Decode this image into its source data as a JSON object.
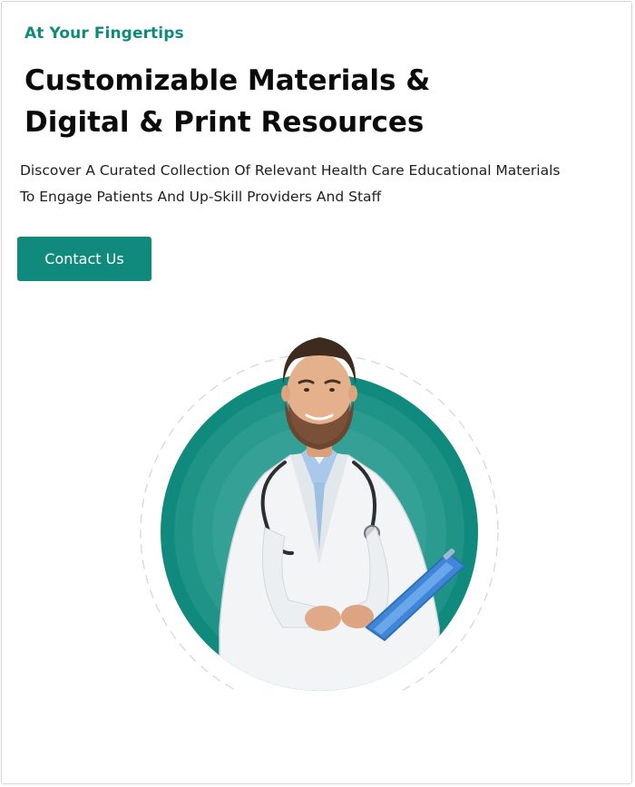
{
  "hero": {
    "eyebrow": "At Your Fingertips",
    "headline_line1": "Customizable Materials &",
    "headline_line2": "Digital & Print Resources",
    "description_line1": "Discover A Curated Collection Of Relevant Health Care Educational Materials",
    "description_line2": "To Engage Patients And Up-Skill Providers And Staff",
    "cta_label": "Contact Us"
  },
  "colors": {
    "accent": "#0f8a7c",
    "headline": "#0b0b0b",
    "body_text": "#1e1e1e",
    "background": "#ffffff"
  },
  "illustration": {
    "subject": "doctor-portrait",
    "icons": [
      "stethoscope-icon",
      "clipboard-icon"
    ]
  }
}
